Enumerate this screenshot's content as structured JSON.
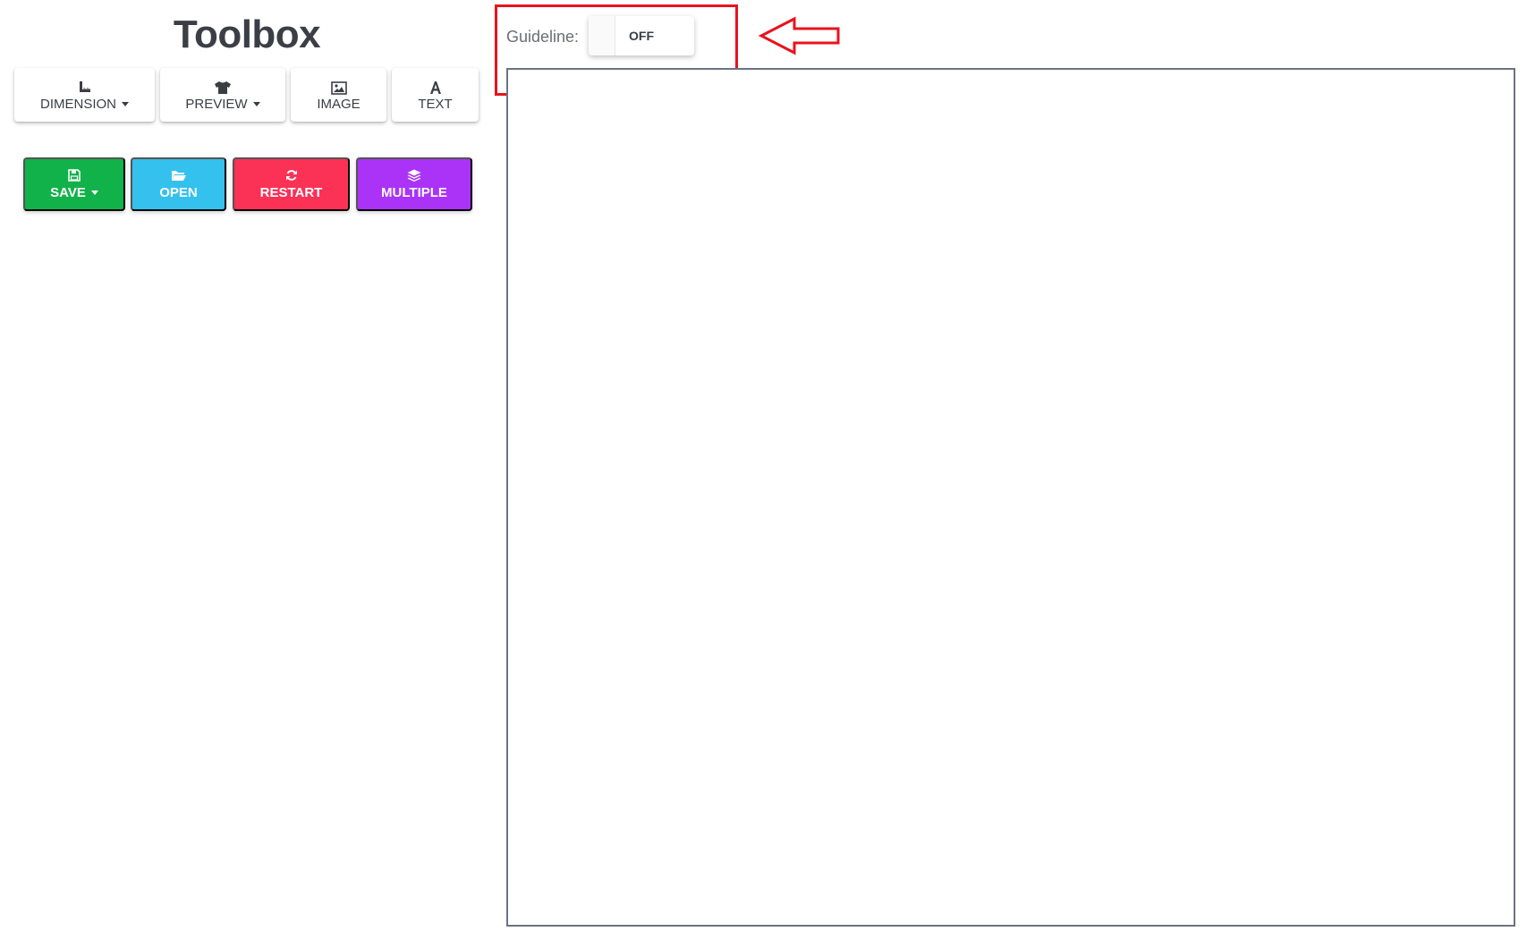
{
  "toolbox": {
    "title": "Toolbox",
    "tools": [
      {
        "id": "dimension",
        "label": "DIMENSION",
        "icon": "ruler-icon",
        "dropdown": true
      },
      {
        "id": "preview",
        "label": "PREVIEW",
        "icon": "tshirt-icon",
        "dropdown": true
      },
      {
        "id": "image",
        "label": "IMAGE",
        "icon": "image-icon",
        "dropdown": false
      },
      {
        "id": "text",
        "label": "TEXT",
        "icon": "text-icon",
        "dropdown": false
      }
    ],
    "actions": [
      {
        "id": "save",
        "label": "SAVE",
        "icon": "floppy-disk-icon",
        "color": "#12b24a",
        "dropdown": true
      },
      {
        "id": "open",
        "label": "OPEN",
        "icon": "folder-open-icon",
        "color": "#34c1ee",
        "dropdown": false
      },
      {
        "id": "restart",
        "label": "RESTART",
        "icon": "refresh-icon",
        "color": "#fb3156",
        "dropdown": false
      },
      {
        "id": "multiple",
        "label": "MULTIPLE",
        "icon": "layers-icon",
        "color": "#aa33f7",
        "dropdown": false
      }
    ]
  },
  "guideline": {
    "label": "Guideline:",
    "state": "OFF"
  },
  "colors": {
    "annotation": "#e8131d",
    "canvas_border": "#6b7280",
    "text_dark": "#3a3d42"
  }
}
